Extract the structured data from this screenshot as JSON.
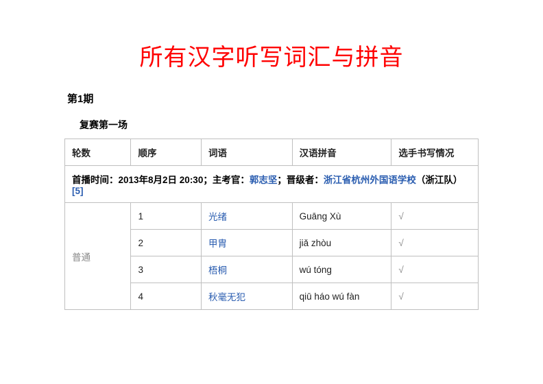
{
  "title": "所有汉字听写词汇与拼音",
  "section": "第1期",
  "subsection": "复赛第一场",
  "headers": {
    "round": "轮数",
    "order": "顺序",
    "word": "词语",
    "pinyin": "汉语拼音",
    "status": "选手书写情况"
  },
  "info": {
    "prefix": "首播时间：2013年8月2日  20:30；主考官：",
    "examiner": "郭志坚",
    "mid": "；晋级者：",
    "qualifier": "浙江省杭州外国语学校",
    "team": "（浙江队）",
    "ref": "[5]"
  },
  "round_label": "普通",
  "rows": [
    {
      "order": "1",
      "word": "光绪",
      "pinyin": "Guāng Xù",
      "status": "√"
    },
    {
      "order": "2",
      "word": "甲胄",
      "pinyin": "jiǎ zhòu",
      "status": "√"
    },
    {
      "order": "3",
      "word": "梧桐",
      "pinyin": "wú tóng",
      "status": "√"
    },
    {
      "order": "4",
      "word": "秋毫无犯",
      "pinyin": "qiū háo wú fàn",
      "status": "√"
    }
  ]
}
